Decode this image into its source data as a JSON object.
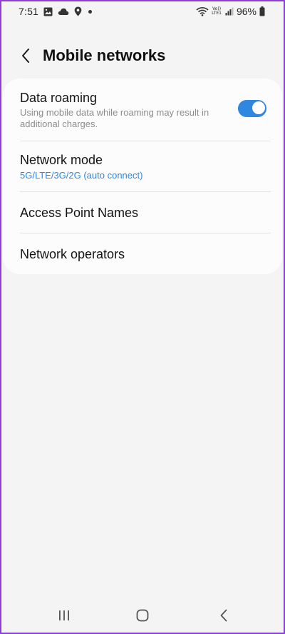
{
  "status_bar": {
    "time": "7:51",
    "left_icons": [
      "image-icon",
      "cloud-icon",
      "location-pin-icon",
      "notification-dot-icon"
    ],
    "volte_top": "Vo))",
    "volte_bottom": "LTE1",
    "battery_percent": "96%"
  },
  "header": {
    "back_icon": "chevron-left-icon",
    "title": "Mobile networks"
  },
  "settings": {
    "data_roaming": {
      "title": "Data roaming",
      "subtitle": "Using mobile data while roaming may result in additional charges.",
      "enabled": true
    },
    "network_mode": {
      "title": "Network mode",
      "value": "5G/LTE/3G/2G (auto connect)"
    },
    "access_point_names": {
      "title": "Access Point Names"
    },
    "network_operators": {
      "title": "Network operators"
    }
  },
  "nav_bar": {
    "recent_icon": "recent-apps-icon",
    "home_icon": "home-icon",
    "back_icon": "back-icon"
  },
  "colors": {
    "accent": "#2f87e0",
    "background": "#f4f4f4",
    "card": "#fcfcfc",
    "frame_border": "#8e3fd6"
  }
}
